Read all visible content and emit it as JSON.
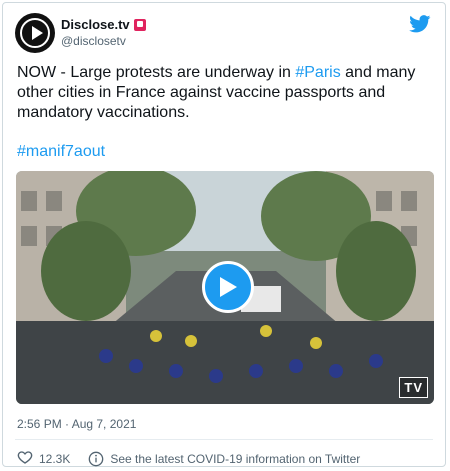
{
  "author": {
    "name": "Disclose.tv",
    "handle": "@disclosetv"
  },
  "tweet": {
    "text_before": "NOW - Large protests are underway in ",
    "link": "#Paris",
    "text_after": " and many other cities in France against vaccine passports and mandatory vaccinations.",
    "hashtag": "#manif7aout"
  },
  "media": {
    "watermark": "TV"
  },
  "meta": {
    "timestamp": "2:56 PM · Aug 7, 2021"
  },
  "actions": {
    "likes": "12.3K",
    "info_text": "See the latest COVID-19 information on Twitter"
  },
  "colors": {
    "accent": "#1d9bf0",
    "badge": "#e0245e"
  }
}
